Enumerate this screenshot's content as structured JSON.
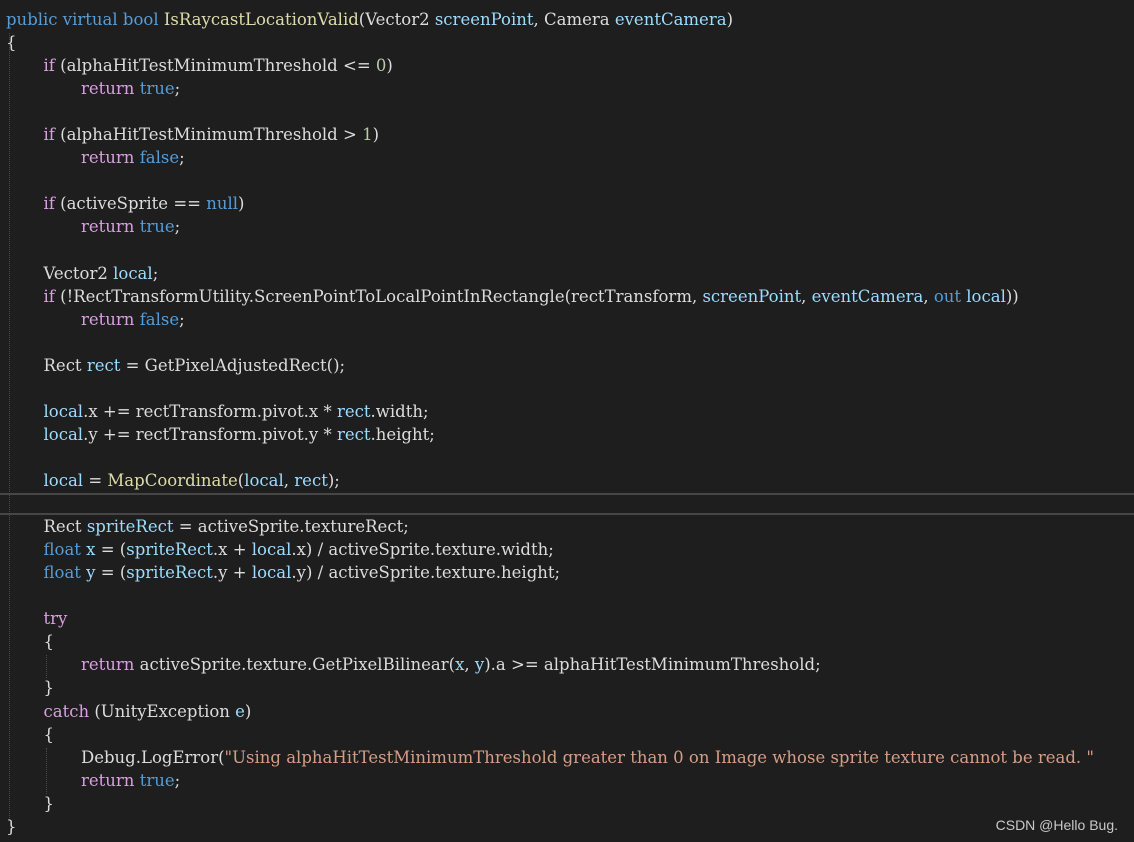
{
  "colors": {
    "background": "#1e1e1e",
    "keyword": "#569cd6",
    "control": "#d8a0df",
    "method": "#dcdcaa",
    "string": "#d69d85",
    "number": "#b5cea8",
    "param": "#9cdcfe",
    "plain": "#dcdcdc",
    "guide": "#4a4a4a",
    "current_line_border": "#464646"
  },
  "watermark": "CSDN @Hello Bug.",
  "code": {
    "lines": [
      {
        "indent": 0,
        "tokens": [
          [
            "public",
            "keyword"
          ],
          [
            " ",
            "plain"
          ],
          [
            "virtual",
            "keyword"
          ],
          [
            " ",
            "plain"
          ],
          [
            "bool",
            "keyword"
          ],
          [
            " ",
            "plain"
          ],
          [
            "IsRaycastLocationValid",
            "method"
          ],
          [
            "(Vector2 ",
            "plain"
          ],
          [
            "screenPoint",
            "param"
          ],
          [
            ", Camera ",
            "plain"
          ],
          [
            "eventCamera",
            "param"
          ],
          [
            ")",
            "plain"
          ]
        ]
      },
      {
        "indent": 0,
        "tokens": [
          [
            "{",
            "plain"
          ]
        ]
      },
      {
        "indent": 1,
        "tokens": [
          [
            "if",
            "control"
          ],
          [
            " (alphaHitTestMinimumThreshold <= ",
            "plain"
          ],
          [
            "0",
            "number"
          ],
          [
            ")",
            "plain"
          ]
        ]
      },
      {
        "indent": 2,
        "tokens": [
          [
            "return",
            "control"
          ],
          [
            " ",
            "plain"
          ],
          [
            "true",
            "keyword"
          ],
          [
            ";",
            "plain"
          ]
        ]
      },
      {
        "indent": 0,
        "tokens": []
      },
      {
        "indent": 1,
        "tokens": [
          [
            "if",
            "control"
          ],
          [
            " (alphaHitTestMinimumThreshold > ",
            "plain"
          ],
          [
            "1",
            "number"
          ],
          [
            ")",
            "plain"
          ]
        ]
      },
      {
        "indent": 2,
        "tokens": [
          [
            "return",
            "control"
          ],
          [
            " ",
            "plain"
          ],
          [
            "false",
            "keyword"
          ],
          [
            ";",
            "plain"
          ]
        ]
      },
      {
        "indent": 0,
        "tokens": []
      },
      {
        "indent": 1,
        "tokens": [
          [
            "if",
            "control"
          ],
          [
            " (activeSprite == ",
            "plain"
          ],
          [
            "null",
            "keyword"
          ],
          [
            ")",
            "plain"
          ]
        ]
      },
      {
        "indent": 2,
        "tokens": [
          [
            "return",
            "control"
          ],
          [
            " ",
            "plain"
          ],
          [
            "true",
            "keyword"
          ],
          [
            ";",
            "plain"
          ]
        ]
      },
      {
        "indent": 0,
        "tokens": []
      },
      {
        "indent": 1,
        "tokens": [
          [
            "Vector2 ",
            "plain"
          ],
          [
            "local",
            "param"
          ],
          [
            ";",
            "plain"
          ]
        ]
      },
      {
        "indent": 1,
        "tokens": [
          [
            "if",
            "control"
          ],
          [
            " (!RectTransformUtility.ScreenPointToLocalPointInRectangle(rectTransform, ",
            "plain"
          ],
          [
            "screenPoint",
            "param"
          ],
          [
            ", ",
            "plain"
          ],
          [
            "eventCamera",
            "param"
          ],
          [
            ", ",
            "plain"
          ],
          [
            "out",
            "keyword"
          ],
          [
            " ",
            "plain"
          ],
          [
            "local",
            "param"
          ],
          [
            "))",
            "plain"
          ]
        ]
      },
      {
        "indent": 2,
        "tokens": [
          [
            "return",
            "control"
          ],
          [
            " ",
            "plain"
          ],
          [
            "false",
            "keyword"
          ],
          [
            ";",
            "plain"
          ]
        ]
      },
      {
        "indent": 0,
        "tokens": []
      },
      {
        "indent": 1,
        "tokens": [
          [
            "Rect ",
            "plain"
          ],
          [
            "rect",
            "param"
          ],
          [
            " = GetPixelAdjustedRect();",
            "plain"
          ]
        ]
      },
      {
        "indent": 0,
        "tokens": []
      },
      {
        "indent": 1,
        "tokens": [
          [
            "local",
            "param"
          ],
          [
            ".x += rectTransform.pivot.x * ",
            "plain"
          ],
          [
            "rect",
            "param"
          ],
          [
            ".width;",
            "plain"
          ]
        ]
      },
      {
        "indent": 1,
        "tokens": [
          [
            "local",
            "param"
          ],
          [
            ".y += rectTransform.pivot.y * ",
            "plain"
          ],
          [
            "rect",
            "param"
          ],
          [
            ".height;",
            "plain"
          ]
        ]
      },
      {
        "indent": 0,
        "tokens": []
      },
      {
        "indent": 1,
        "tokens": [
          [
            "local",
            "param"
          ],
          [
            " = ",
            "plain"
          ],
          [
            "MapCoordinate",
            "method"
          ],
          [
            "(",
            "plain"
          ],
          [
            "local",
            "param"
          ],
          [
            ", ",
            "plain"
          ],
          [
            "rect",
            "param"
          ],
          [
            ");",
            "plain"
          ]
        ]
      },
      {
        "indent": 0,
        "tokens": []
      },
      {
        "indent": 1,
        "tokens": [
          [
            "Rect ",
            "plain"
          ],
          [
            "spriteRect",
            "param"
          ],
          [
            " = activeSprite.textureRect;",
            "plain"
          ]
        ]
      },
      {
        "indent": 1,
        "tokens": [
          [
            "float",
            "keyword"
          ],
          [
            " ",
            "plain"
          ],
          [
            "x",
            "param"
          ],
          [
            " = (",
            "plain"
          ],
          [
            "spriteRect",
            "param"
          ],
          [
            ".x + ",
            "plain"
          ],
          [
            "local",
            "param"
          ],
          [
            ".x) / activeSprite.texture.width;",
            "plain"
          ]
        ]
      },
      {
        "indent": 1,
        "tokens": [
          [
            "float",
            "keyword"
          ],
          [
            " ",
            "plain"
          ],
          [
            "y",
            "param"
          ],
          [
            " = (",
            "plain"
          ],
          [
            "spriteRect",
            "param"
          ],
          [
            ".y + ",
            "plain"
          ],
          [
            "local",
            "param"
          ],
          [
            ".y) / activeSprite.texture.height;",
            "plain"
          ]
        ]
      },
      {
        "indent": 0,
        "tokens": []
      },
      {
        "indent": 1,
        "tokens": [
          [
            "try",
            "control"
          ]
        ]
      },
      {
        "indent": 1,
        "tokens": [
          [
            "{",
            "plain"
          ]
        ]
      },
      {
        "indent": 2,
        "tokens": [
          [
            "return",
            "control"
          ],
          [
            " activeSprite.texture.GetPixelBilinear(",
            "plain"
          ],
          [
            "x",
            "param"
          ],
          [
            ", ",
            "plain"
          ],
          [
            "y",
            "param"
          ],
          [
            ").a >= alphaHitTestMinimumThreshold;",
            "plain"
          ]
        ]
      },
      {
        "indent": 1,
        "tokens": [
          [
            "}",
            "plain"
          ]
        ]
      },
      {
        "indent": 1,
        "tokens": [
          [
            "catch",
            "control"
          ],
          [
            " (UnityException ",
            "plain"
          ],
          [
            "e",
            "param"
          ],
          [
            ")",
            "plain"
          ]
        ]
      },
      {
        "indent": 1,
        "tokens": [
          [
            "{",
            "plain"
          ]
        ]
      },
      {
        "indent": 2,
        "tokens": [
          [
            "Debug.LogError(",
            "plain"
          ],
          [
            "\"Using alphaHitTestMinimumThreshold greater than 0 on Image whose sprite texture cannot be read. \"",
            "string"
          ]
        ]
      },
      {
        "indent": 2,
        "tokens": [
          [
            "return",
            "control"
          ],
          [
            " ",
            "plain"
          ],
          [
            "true",
            "keyword"
          ],
          [
            ";",
            "plain"
          ]
        ]
      },
      {
        "indent": 1,
        "tokens": [
          [
            "}",
            "plain"
          ]
        ]
      },
      {
        "indent": 0,
        "tokens": [
          [
            "}",
            "plain"
          ]
        ]
      }
    ]
  }
}
